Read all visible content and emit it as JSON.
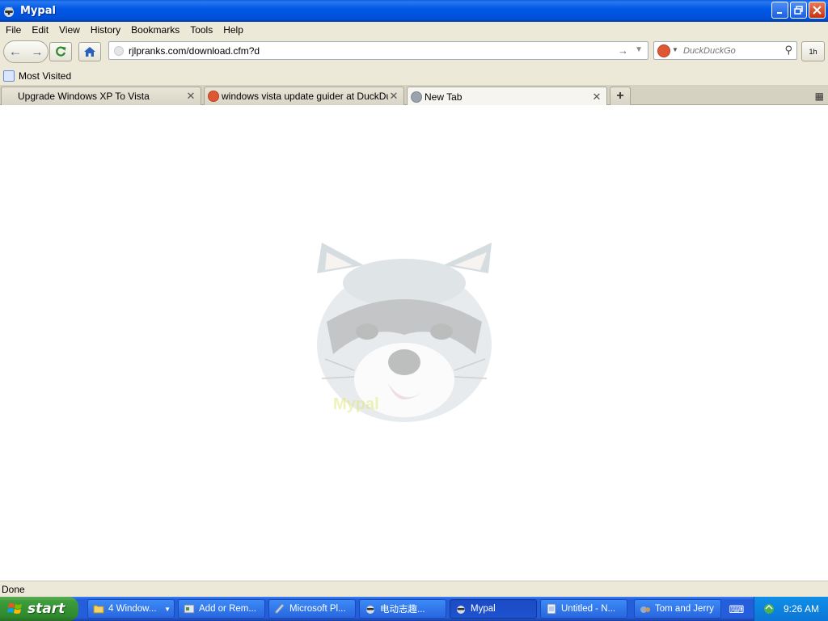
{
  "window": {
    "title": "Mypal"
  },
  "menu": [
    "File",
    "Edit",
    "View",
    "History",
    "Bookmarks",
    "Tools",
    "Help"
  ],
  "nav": {
    "url": "rjlpranks.com/download.cfm?d",
    "search_placeholder": "DuckDuckGo",
    "ext_label": "1h"
  },
  "bookmarks": {
    "most_visited": "Most Visited"
  },
  "tabs": [
    {
      "label": "Upgrade Windows XP To Vista",
      "active": false
    },
    {
      "label": "windows vista update guider at DuckDuc...",
      "active": false
    },
    {
      "label": "New Tab",
      "active": true
    }
  ],
  "content": {
    "logo_text": "Mypal"
  },
  "status": {
    "text": "Done"
  },
  "taskbar": {
    "start_label": "start",
    "items": [
      {
        "label": "4 Window...",
        "active": false
      },
      {
        "label": "Add or Rem...",
        "active": false
      },
      {
        "label": "Microsoft Pl...",
        "active": false
      },
      {
        "label": "电动志趣...",
        "active": false
      },
      {
        "label": "Mypal",
        "active": true
      },
      {
        "label": "Untitled - N...",
        "active": false
      },
      {
        "label": "Tom and Jerry",
        "active": false
      }
    ],
    "clock": "9:26 AM"
  },
  "colors": {
    "titlebar": "#0054e3",
    "taskbar": "#245edb",
    "start": "#3c9c3a",
    "chrome": "#ece9d8"
  }
}
